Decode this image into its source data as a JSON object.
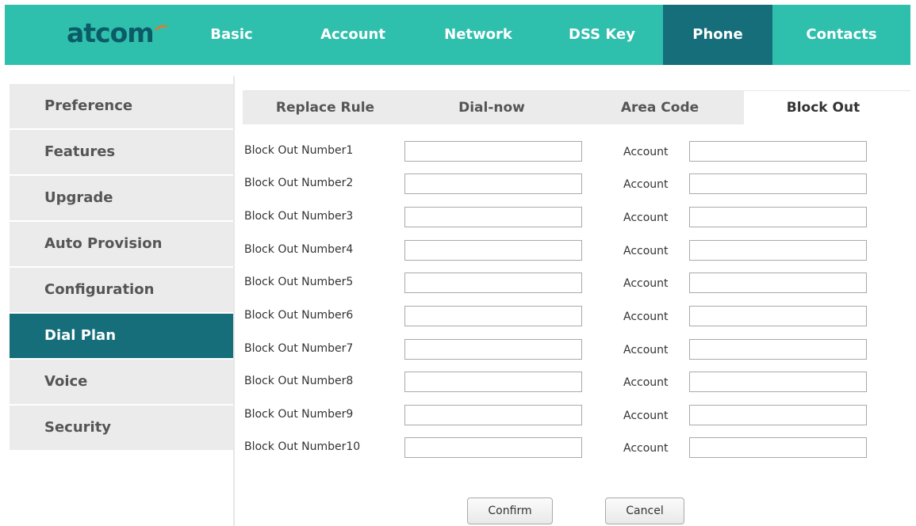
{
  "header": {
    "logo": "atcom",
    "nav": [
      {
        "label": "Basic",
        "active": false
      },
      {
        "label": "Account",
        "active": false
      },
      {
        "label": "Network",
        "active": false
      },
      {
        "label": "DSS Key",
        "active": false
      },
      {
        "label": "Phone",
        "active": true
      },
      {
        "label": "Contacts",
        "active": false
      }
    ]
  },
  "sidebar": {
    "items": [
      {
        "label": "Preference",
        "active": false
      },
      {
        "label": "Features",
        "active": false
      },
      {
        "label": "Upgrade",
        "active": false
      },
      {
        "label": "Auto Provision",
        "active": false
      },
      {
        "label": "Configuration",
        "active": false
      },
      {
        "label": "Dial Plan",
        "active": true
      },
      {
        "label": "Voice",
        "active": false
      },
      {
        "label": "Security",
        "active": false
      }
    ]
  },
  "tabs": [
    {
      "label": "Replace Rule",
      "active": false
    },
    {
      "label": "Dial-now",
      "active": false
    },
    {
      "label": "Area Code",
      "active": false
    },
    {
      "label": "Block Out",
      "active": true
    }
  ],
  "form": {
    "rows": [
      {
        "label": "Block Out Number1",
        "number": "",
        "account_label": "Account",
        "account": ""
      },
      {
        "label": "Block Out Number2",
        "number": "",
        "account_label": "Account",
        "account": ""
      },
      {
        "label": "Block Out Number3",
        "number": "",
        "account_label": "Account",
        "account": ""
      },
      {
        "label": "Block Out Number4",
        "number": "",
        "account_label": "Account",
        "account": ""
      },
      {
        "label": "Block Out Number5",
        "number": "",
        "account_label": "Account",
        "account": ""
      },
      {
        "label": "Block Out Number6",
        "number": "",
        "account_label": "Account",
        "account": ""
      },
      {
        "label": "Block Out Number7",
        "number": "",
        "account_label": "Account",
        "account": ""
      },
      {
        "label": "Block Out Number8",
        "number": "",
        "account_label": "Account",
        "account": ""
      },
      {
        "label": "Block Out Number9",
        "number": "",
        "account_label": "Account",
        "account": ""
      },
      {
        "label": "Block Out Number10",
        "number": "",
        "account_label": "Account",
        "account": ""
      }
    ],
    "confirm_label": "Confirm",
    "cancel_label": "Cancel"
  },
  "colors": {
    "header_bg": "#2fbfad",
    "active_bg": "#166e7b",
    "logo_accent": "#e8762b"
  }
}
